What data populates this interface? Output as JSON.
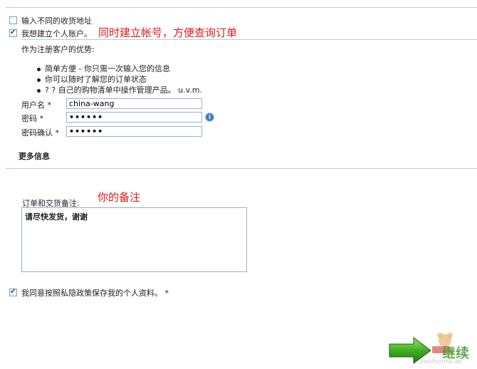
{
  "shipping": {
    "different_address_label": "输入不同的收货地址",
    "different_address_checked": false
  },
  "account": {
    "create_account_label": "我想建立个人账户。",
    "create_account_checked": true,
    "annotation": "同时建立帐号，方便查询订单",
    "benefits_title": "作为注册客户的优势:",
    "benefits": [
      "简单方便 - 你只需一次输入您的信息",
      "你可以随时了解您的订单状态",
      "? ? 自己的购物清单中操作管理产品。 u.v.m."
    ],
    "username_label": "用户名 *",
    "username_value": "china-wang",
    "password_label": "密码 *",
    "password_value": "••••••",
    "confirm_label": "密码确认 *",
    "confirm_value": "••••••"
  },
  "more_info": {
    "title": "更多信息",
    "notes_label": "订单和交货备注:",
    "notes_annotation": "你的备注",
    "notes_value": "请尽快发货，谢谢"
  },
  "privacy": {
    "label": "我同意按照私隐政策保存我的个人资料。 *",
    "checked": true
  },
  "footer": {
    "continue_label": "继续",
    "watermark": "youhuima.de"
  }
}
